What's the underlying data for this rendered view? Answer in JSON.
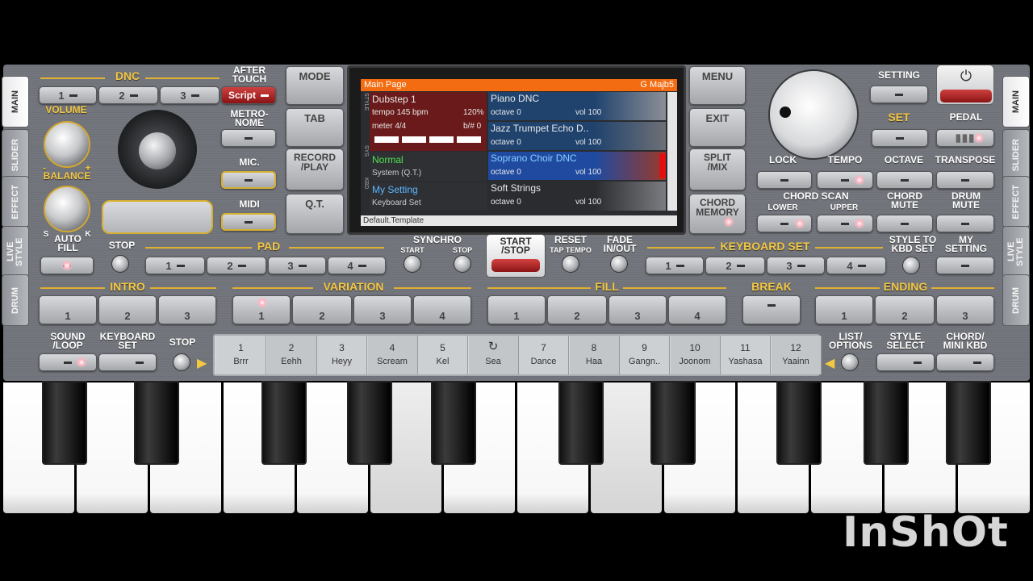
{
  "side_tabs_left": [
    "MAIN",
    "SLIDER",
    "EFFECT",
    "LIVE STYLE",
    "DRUM"
  ],
  "side_tabs_right": [
    "MAIN",
    "SLIDER",
    "EFFECT",
    "LIVE STYLE",
    "DRUM"
  ],
  "dnc": {
    "label": "DNC",
    "buttons": [
      "1",
      "2",
      "3"
    ],
    "after_touch": "AFTER TOUCH",
    "script": "Script"
  },
  "volume": "VOLUME",
  "balance": "BALANCE",
  "balance_s": "S",
  "balance_k": "K",
  "minus": "-",
  "plus": "+",
  "metronome": "METRO-NOME",
  "mic": "MIC.",
  "midi": "MIDI",
  "mode_col": {
    "mode": "MODE",
    "tab": "TAB",
    "record": "RECORD /PLAY",
    "qt": "Q.T."
  },
  "menu_col": {
    "menu": "MENU",
    "exit": "EXIT",
    "split": "SPLIT /MIX",
    "chord_memory": "CHORD MEMORY"
  },
  "screen": {
    "title": "Main Page",
    "chord": "G Majb5",
    "style_name": "Dubstep 1",
    "tempo": "tempo 145 bpm",
    "tempo_pct": "120%",
    "meter": "meter 4/4",
    "bs": "b/# 0",
    "normal": "Normal",
    "system": "System (Q.T.)",
    "my_setting": "My Setting",
    "keyboard_set": "Keyboard Set",
    "up1": {
      "name": "Piano DNC",
      "octave": "octave 0",
      "vol": "vol 100"
    },
    "up2": {
      "name": "Jazz Trumpet Echo D..",
      "octave": "octave 0",
      "vol": "vol 100"
    },
    "up3": {
      "name": "Soprano Choir DNC",
      "octave": "octave 0",
      "vol": "vol 100"
    },
    "low": {
      "name": "Soft Strings",
      "octave": "octave 0",
      "vol": "vol 100"
    },
    "footer": "Default.Template",
    "side_style": "STYLE",
    "side_sys": "SYS",
    "side_kbd": "KBD"
  },
  "right": {
    "setting": "SETTING",
    "set": "SET",
    "pedal": "PEDAL",
    "lock": "LOCK",
    "tempo": "TEMPO",
    "octave": "OCTAVE",
    "transpose": "TRANSPOSE",
    "chord_scan": "CHORD SCAN",
    "lower": "LOWER",
    "upper": "UPPER",
    "chord_mute": "CHORD MUTE",
    "drum_mute": "DRUM MUTE"
  },
  "row2": {
    "auto_fill": "AUTO FILL",
    "stop": "STOP",
    "pad": "PAD",
    "pad_buttons": [
      "1",
      "2",
      "3",
      "4"
    ],
    "synchro": "SYNCHRO",
    "start": "START",
    "stop2": "STOP",
    "start_stop": "START /STOP",
    "reset": "RESET",
    "tap_tempo": "TAP TEMPO",
    "fade": "FADE IN/OUT",
    "keyboard_set": "KEYBOARD SET",
    "kbd_buttons": [
      "1",
      "2",
      "3",
      "4"
    ],
    "style_to_kbd": "STYLE TO KBD SET",
    "my_setting": "MY SETTING"
  },
  "row3": {
    "intro": "INTRO",
    "intro_btns": [
      "1",
      "2",
      "3"
    ],
    "variation": "VARIATION",
    "var_btns": [
      "1",
      "2",
      "3",
      "4"
    ],
    "fill": "FILL",
    "fill_btns": [
      "1",
      "2",
      "3",
      "4"
    ],
    "break": "BREAK",
    "ending": "ENDING",
    "end_btns": [
      "1",
      "2",
      "3"
    ]
  },
  "row4": {
    "sound_loop": "SOUND /LOOP",
    "keyboard_set": "KEYBOARD SET",
    "stop": "STOP",
    "list_options": "LIST/ OPTIONS",
    "style_select": "STYLE SELECT",
    "chord_mini": "CHORD/ MINI KBD"
  },
  "sounds": [
    {
      "n": "1",
      "name": "Brrr"
    },
    {
      "n": "2",
      "name": "Eehh"
    },
    {
      "n": "3",
      "name": "Heyy"
    },
    {
      "n": "4",
      "name": "Scream"
    },
    {
      "n": "5",
      "name": "Kel"
    },
    {
      "n": "",
      "name": "Sea"
    },
    {
      "n": "7",
      "name": "Dance"
    },
    {
      "n": "8",
      "name": "Haa"
    },
    {
      "n": "9",
      "name": "Gangn.."
    },
    {
      "n": "10",
      "name": "Joonom"
    },
    {
      "n": "11",
      "name": "Yashasa"
    },
    {
      "n": "12",
      "name": "Yaainn"
    }
  ],
  "watermark": "InShOt"
}
